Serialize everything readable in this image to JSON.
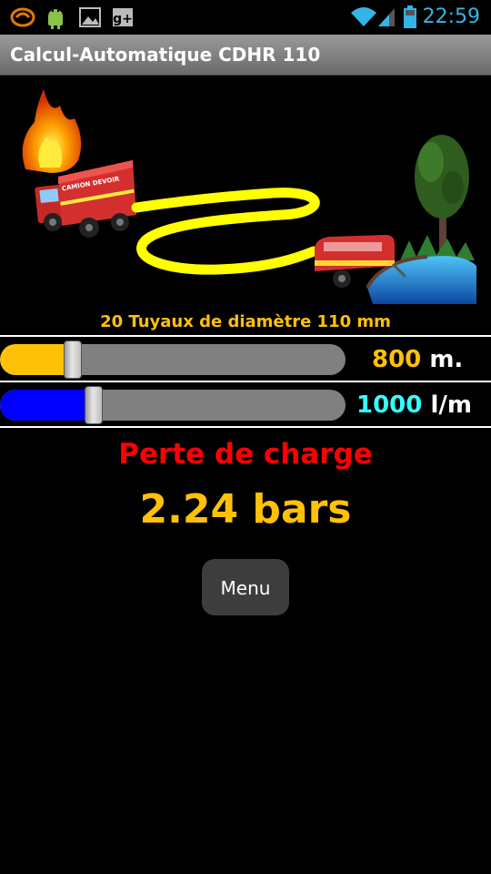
{
  "status_bar": {
    "time": "22:59",
    "icons": [
      "debug-icon",
      "android-icon",
      "gallery-icon",
      "google-plus-icon",
      "wifi-icon",
      "signal-icon",
      "battery-icon"
    ]
  },
  "app": {
    "title": "Calcul-Automatique CDHR 110"
  },
  "illustration": {
    "truck_label": "CAMION DEVOIR"
  },
  "caption": "20 Tuyaux de diamètre 110 mm",
  "sliders": {
    "length": {
      "value": "800",
      "unit": "m.",
      "fill_fraction": 0.21,
      "fill_color": "#ffc107",
      "value_color": "#ffc107"
    },
    "flow": {
      "value": "1000",
      "unit": "l/m",
      "fill_fraction": 0.27,
      "fill_color": "#0000ff",
      "value_color": "#33ffff"
    }
  },
  "result": {
    "label": "Perte de charge",
    "value": "2.24 bars"
  },
  "menu": {
    "label": "Menu"
  }
}
